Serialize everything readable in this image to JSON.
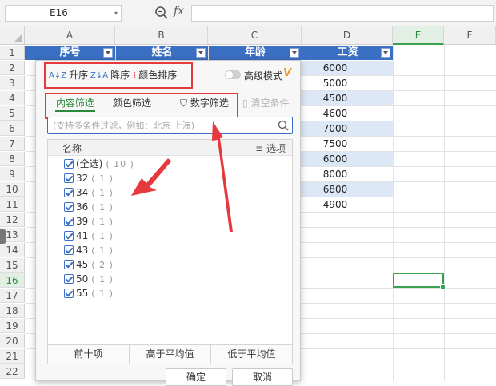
{
  "formula_bar": {
    "name_box": "E16",
    "fx_label": "fx"
  },
  "columns": [
    "A",
    "B",
    "C",
    "D",
    "E",
    "F"
  ],
  "rows": [
    "1",
    "2",
    "3",
    "4",
    "5",
    "6",
    "7",
    "8",
    "9",
    "10",
    "11",
    "12",
    "13",
    "14",
    "15",
    "16",
    "17",
    "18",
    "19",
    "20",
    "21",
    "22"
  ],
  "table_header": {
    "col_a": "序号",
    "col_b": "姓名",
    "col_c": "年龄",
    "col_d": "工资"
  },
  "wages": [
    "6000",
    "5000",
    "4500",
    "4600",
    "7000",
    "7500",
    "6000",
    "8000",
    "6800",
    "4900"
  ],
  "filter_panel": {
    "sort_asc": "升序",
    "sort_desc": "降序",
    "sort_color": "颜色排序",
    "advanced_mode": "高级模式",
    "vip_badge": "V",
    "tab_content": "内容筛选",
    "tab_color": "颜色筛选",
    "number_filter": "数字筛选",
    "clear_condition": "清空条件",
    "search_placeholder": "(支持多条件过滤，例如：北京 上海)",
    "list_header": "名称",
    "options_label": "选项",
    "items": [
      {
        "label": "(全选)",
        "count": "( 10 )"
      },
      {
        "label": "32",
        "count": "( 1 )"
      },
      {
        "label": "34",
        "count": "( 1 )"
      },
      {
        "label": "36",
        "count": "( 1 )"
      },
      {
        "label": "39",
        "count": "( 1 )"
      },
      {
        "label": "41",
        "count": "( 1 )"
      },
      {
        "label": "43",
        "count": "( 1 )"
      },
      {
        "label": "45",
        "count": "( 2 )"
      },
      {
        "label": "50",
        "count": "( 1 )"
      },
      {
        "label": "55",
        "count": "( 1 )"
      }
    ],
    "top_ten": "前十项",
    "above_avg": "高于平均值",
    "below_avg": "低于平均值",
    "ok": "确定",
    "cancel": "取消"
  },
  "colors": {
    "header_blue": "#3b6fc3",
    "band_blue": "#dce8f6",
    "active_green": "#3aa150",
    "annotation_red": "#e6393e",
    "vip_orange": "#f39a1e"
  }
}
